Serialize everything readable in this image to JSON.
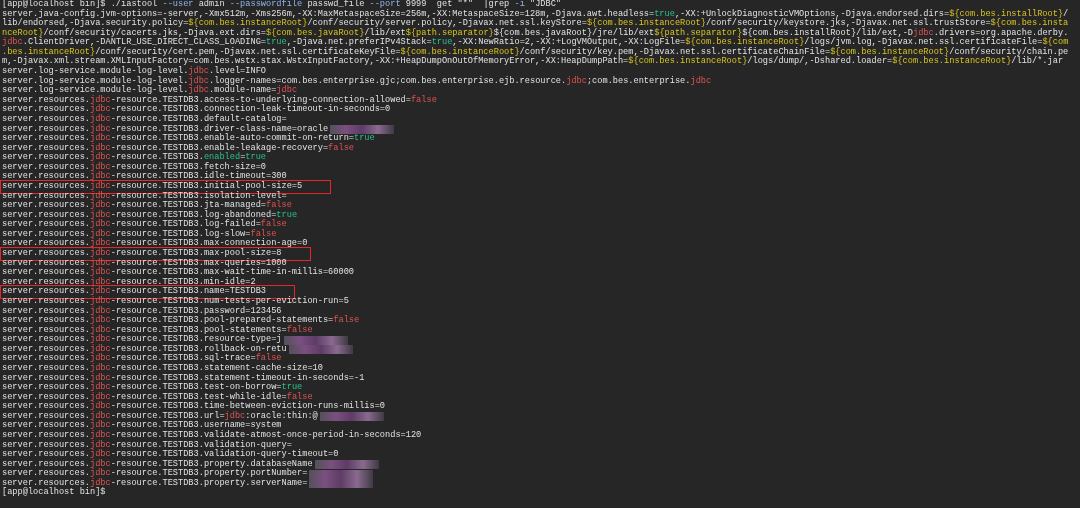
{
  "terminal": {
    "rows": [
      {
        "highlighted": false,
        "redacted": false,
        "segments": [
          {
            "kind": "plain",
            "text": "[app@localhost bin]$ ./iastool "
          },
          {
            "kind": "option",
            "text": "--user"
          },
          {
            "kind": "plain",
            "text": " admin "
          },
          {
            "kind": "option",
            "text": "--passwordfile"
          },
          {
            "kind": "plain",
            "text": " passwd_file "
          },
          {
            "kind": "option",
            "text": "--port"
          },
          {
            "kind": "plain",
            "text": " 9999  get \"*\"  |grep "
          },
          {
            "kind": "option",
            "text": "-i"
          },
          {
            "kind": "plain",
            "text": " \"JDBC\""
          }
        ]
      },
      {
        "highlighted": false,
        "redacted": false,
        "segments": [
          {
            "kind": "plain",
            "text": "server.java-config.jvm-options=-server,-Xmx512m,-Xms256m,-XX:MaxMetaspaceSize=256m,-XX:MetaspaceSize=128m,-Djava.awt.headless="
          },
          {
            "kind": "true",
            "text": "true"
          },
          {
            "kind": "plain",
            "text": ",-XX:+UnlockDiagnosticVMOptions,-Djava.endorsed.dirs="
          },
          {
            "kind": "var",
            "text": "${com.bes.installRoot}"
          },
          {
            "kind": "plain",
            "text": "/"
          }
        ]
      },
      {
        "highlighted": false,
        "redacted": false,
        "segments": [
          {
            "kind": "plain",
            "text": "lib/endorsed,-Djava.security.policy="
          },
          {
            "kind": "var",
            "text": "${com.bes.instanceRoot}"
          },
          {
            "kind": "plain",
            "text": "/conf/security/server.policy,-Djavax.net.ssl.keyStore="
          },
          {
            "kind": "var",
            "text": "${com.bes.instanceRoot}"
          },
          {
            "kind": "plain",
            "text": "/conf/security/keystore.jks,-Djavax.net.ssl.trustStore="
          },
          {
            "kind": "var",
            "text": "${com.bes.insta"
          }
        ]
      },
      {
        "highlighted": false,
        "redacted": false,
        "segments": [
          {
            "kind": "var",
            "text": "nceRoot}"
          },
          {
            "kind": "plain",
            "text": "/conf/security/cacerts.jks,-Djava.ext.dirs="
          },
          {
            "kind": "var",
            "text": "${com.bes.javaRoot}"
          },
          {
            "kind": "plain",
            "text": "/lib/ext"
          },
          {
            "kind": "var",
            "text": "${path.separator}"
          },
          {
            "kind": "plain",
            "text": "${com.bes.javaRoot}/jre/lib/ext"
          },
          {
            "kind": "var",
            "text": "${path.separator}"
          },
          {
            "kind": "plain",
            "text": "${com.bes.installRoot}/lib/ext,-D"
          },
          {
            "kind": "keyword",
            "text": "jdbc"
          },
          {
            "kind": "plain",
            "text": ".drivers=org.apache.derby."
          }
        ]
      },
      {
        "highlighted": false,
        "redacted": false,
        "segments": [
          {
            "kind": "keyword",
            "text": "jdbc"
          },
          {
            "kind": "plain",
            "text": ".ClientDriver,-DANTLR_USE_DIRECT_CLASS_LOADING="
          },
          {
            "kind": "true",
            "text": "true"
          },
          {
            "kind": "plain",
            "text": ",-Djava.net.preferIPv4Stack="
          },
          {
            "kind": "true",
            "text": "true"
          },
          {
            "kind": "plain",
            "text": ",-XX:NewRatio=2,-XX:+LogVMOutput,-XX:LogFile="
          },
          {
            "kind": "var",
            "text": "${com.bes.instanceRoot}"
          },
          {
            "kind": "plain",
            "text": "/logs/jvm.log,-Djavax.net.ssl.certificateFile="
          },
          {
            "kind": "var",
            "text": "${com"
          }
        ]
      },
      {
        "highlighted": false,
        "redacted": false,
        "segments": [
          {
            "kind": "var",
            "text": ".bes.instanceRoot}"
          },
          {
            "kind": "plain",
            "text": "/conf/security/cert.pem,-Djavax.net.ssl.certificateKeyFile="
          },
          {
            "kind": "var",
            "text": "${com.bes.instanceRoot}"
          },
          {
            "kind": "plain",
            "text": "/conf/security/key.pem,-Djavax.net.ssl.certificateChainFile="
          },
          {
            "kind": "var",
            "text": "${com.bes.instanceRoot}"
          },
          {
            "kind": "plain",
            "text": "/conf/security/chain.pe"
          }
        ]
      },
      {
        "highlighted": false,
        "redacted": false,
        "segments": [
          {
            "kind": "plain",
            "text": "m,-Djavax.xml.stream.XMLInputFactory=com.bes.wstx.stax.WstxInputFactory,-XX:+HeapDumpOnOutOfMemoryError,-XX:HeapDumpPath="
          },
          {
            "kind": "var",
            "text": "${com.bes.instanceRoot}"
          },
          {
            "kind": "plain",
            "text": "/logs/dump/,-Dshared.loader="
          },
          {
            "kind": "var",
            "text": "${com.bes.instanceRoot}"
          },
          {
            "kind": "plain",
            "text": "/lib/*.jar"
          }
        ]
      },
      {
        "highlighted": false,
        "redacted": false,
        "segments": [
          {
            "kind": "plain",
            "text": "server.log-service.module-log-level."
          },
          {
            "kind": "keyword",
            "text": "jdbc"
          },
          {
            "kind": "plain",
            "text": ".level=INFO"
          }
        ]
      },
      {
        "highlighted": false,
        "redacted": false,
        "segments": [
          {
            "kind": "plain",
            "text": "server.log-service.module-log-level."
          },
          {
            "kind": "keyword",
            "text": "jdbc"
          },
          {
            "kind": "plain",
            "text": ".logger-names=com.bes.enterprise.gjc;com.bes.enterprise.ejb.resource."
          },
          {
            "kind": "keyword",
            "text": "jdbc"
          },
          {
            "kind": "plain",
            "text": ";com.bes.enterprise."
          },
          {
            "kind": "keyword",
            "text": "jdbc"
          }
        ]
      },
      {
        "highlighted": false,
        "redacted": false,
        "segments": [
          {
            "kind": "plain",
            "text": "server.log-service.module-log-level."
          },
          {
            "kind": "keyword",
            "text": "jdbc"
          },
          {
            "kind": "plain",
            "text": ".module-name="
          },
          {
            "kind": "keyword",
            "text": "jdbc"
          }
        ]
      },
      {
        "highlighted": false,
        "redacted": false,
        "segments": [
          {
            "kind": "plain",
            "text": "server.resources."
          },
          {
            "kind": "keyword",
            "text": "jdbc"
          },
          {
            "kind": "plain",
            "text": "-resource.TESTDB3.access-to-underlying-connection-allowed="
          },
          {
            "kind": "false",
            "text": "false"
          }
        ]
      },
      {
        "highlighted": false,
        "redacted": false,
        "segments": [
          {
            "kind": "plain",
            "text": "server.resources."
          },
          {
            "kind": "keyword",
            "text": "jdbc"
          },
          {
            "kind": "plain",
            "text": "-resource.TESTDB3.connection-leak-timeout-in-seconds=0"
          }
        ]
      },
      {
        "highlighted": false,
        "redacted": false,
        "segments": [
          {
            "kind": "plain",
            "text": "server.resources."
          },
          {
            "kind": "keyword",
            "text": "jdbc"
          },
          {
            "kind": "plain",
            "text": "-resource.TESTDB3.default-catalog="
          }
        ]
      },
      {
        "highlighted": false,
        "redacted": true,
        "segments": [
          {
            "kind": "plain",
            "text": "server.resources."
          },
          {
            "kind": "keyword",
            "text": "jdbc"
          },
          {
            "kind": "plain",
            "text": "-resource.TESTDB3.driver-class-name=oracle"
          }
        ]
      },
      {
        "highlighted": false,
        "redacted": false,
        "segments": [
          {
            "kind": "plain",
            "text": "server.resources."
          },
          {
            "kind": "keyword",
            "text": "jdbc"
          },
          {
            "kind": "plain",
            "text": "-resource.TESTDB3.enable-auto-commit-on-return="
          },
          {
            "kind": "true",
            "text": "true"
          }
        ]
      },
      {
        "highlighted": false,
        "redacted": false,
        "segments": [
          {
            "kind": "plain",
            "text": "server.resources."
          },
          {
            "kind": "keyword",
            "text": "jdbc"
          },
          {
            "kind": "plain",
            "text": "-resource.TESTDB3.enable-leakage-recovery="
          },
          {
            "kind": "false",
            "text": "false"
          }
        ]
      },
      {
        "highlighted": false,
        "redacted": false,
        "segments": [
          {
            "kind": "plain",
            "text": "server.resources."
          },
          {
            "kind": "keyword",
            "text": "jdbc"
          },
          {
            "kind": "plain",
            "text": "-resource.TESTDB3."
          },
          {
            "kind": "true",
            "text": "enabled"
          },
          {
            "kind": "plain",
            "text": "="
          },
          {
            "kind": "true",
            "text": "true"
          }
        ]
      },
      {
        "highlighted": false,
        "redacted": false,
        "segments": [
          {
            "kind": "plain",
            "text": "server.resources."
          },
          {
            "kind": "keyword",
            "text": "jdbc"
          },
          {
            "kind": "plain",
            "text": "-resource.TESTDB3.fetch-size=0"
          }
        ]
      },
      {
        "highlighted": false,
        "redacted": false,
        "segments": [
          {
            "kind": "plain",
            "text": "server.resources."
          },
          {
            "kind": "keyword",
            "text": "jdbc"
          },
          {
            "kind": "plain",
            "text": "-resource.TESTDB3.idle-timeout=300"
          }
        ]
      },
      {
        "highlighted": true,
        "redacted": false,
        "segments": [
          {
            "kind": "plain",
            "text": "server.resources."
          },
          {
            "kind": "keyword",
            "text": "jdbc"
          },
          {
            "kind": "plain",
            "text": "-resource.TESTDB3.initial-pool-size=5"
          }
        ]
      },
      {
        "highlighted": false,
        "redacted": false,
        "segments": [
          {
            "kind": "plain",
            "text": "server.resources."
          },
          {
            "kind": "keyword",
            "text": "jdbc"
          },
          {
            "kind": "plain",
            "text": "-resource.TESTDB3.isolation-level="
          }
        ]
      },
      {
        "highlighted": false,
        "redacted": false,
        "segments": [
          {
            "kind": "plain",
            "text": "server.resources."
          },
          {
            "kind": "keyword",
            "text": "jdbc"
          },
          {
            "kind": "plain",
            "text": "-resource.TESTDB3.jta-managed="
          },
          {
            "kind": "false",
            "text": "false"
          }
        ]
      },
      {
        "highlighted": false,
        "redacted": false,
        "segments": [
          {
            "kind": "plain",
            "text": "server.resources."
          },
          {
            "kind": "keyword",
            "text": "jdbc"
          },
          {
            "kind": "plain",
            "text": "-resource.TESTDB3.log-abandoned="
          },
          {
            "kind": "true",
            "text": "true"
          }
        ]
      },
      {
        "highlighted": false,
        "redacted": false,
        "segments": [
          {
            "kind": "plain",
            "text": "server.resources."
          },
          {
            "kind": "keyword",
            "text": "jdbc"
          },
          {
            "kind": "plain",
            "text": "-resource.TESTDB3.log-failed="
          },
          {
            "kind": "false",
            "text": "false"
          }
        ]
      },
      {
        "highlighted": false,
        "redacted": false,
        "segments": [
          {
            "kind": "plain",
            "text": "server.resources."
          },
          {
            "kind": "keyword",
            "text": "jdbc"
          },
          {
            "kind": "plain",
            "text": "-resource.TESTDB3.log-slow="
          },
          {
            "kind": "false",
            "text": "false"
          }
        ]
      },
      {
        "highlighted": false,
        "redacted": false,
        "segments": [
          {
            "kind": "plain",
            "text": "server.resources."
          },
          {
            "kind": "keyword",
            "text": "jdbc"
          },
          {
            "kind": "plain",
            "text": "-resource.TESTDB3.max-connection-age=0"
          }
        ]
      },
      {
        "highlighted": true,
        "redacted": false,
        "segments": [
          {
            "kind": "plain",
            "text": "server.resources."
          },
          {
            "kind": "keyword",
            "text": "jdbc"
          },
          {
            "kind": "plain",
            "text": "-resource.TESTDB3.max-pool-size=8"
          }
        ]
      },
      {
        "highlighted": false,
        "redacted": false,
        "segments": [
          {
            "kind": "plain",
            "text": "server.resources."
          },
          {
            "kind": "keyword",
            "text": "jdbc"
          },
          {
            "kind": "plain",
            "text": "-resource.TESTDB3.max-queries=1000"
          }
        ]
      },
      {
        "highlighted": false,
        "redacted": false,
        "segments": [
          {
            "kind": "plain",
            "text": "server.resources."
          },
          {
            "kind": "keyword",
            "text": "jdbc"
          },
          {
            "kind": "plain",
            "text": "-resource.TESTDB3.max-wait-time-in-millis=60000"
          }
        ]
      },
      {
        "highlighted": false,
        "redacted": false,
        "segments": [
          {
            "kind": "plain",
            "text": "server.resources."
          },
          {
            "kind": "keyword",
            "text": "jdbc"
          },
          {
            "kind": "plain",
            "text": "-resource.TESTDB3.min-idle=2"
          }
        ]
      },
      {
        "highlighted": true,
        "redacted": false,
        "segments": [
          {
            "kind": "plain",
            "text": "server.resources."
          },
          {
            "kind": "keyword",
            "text": "jdbc"
          },
          {
            "kind": "plain",
            "text": "-resource.TESTDB3.name=TESTDB3"
          }
        ]
      },
      {
        "highlighted": false,
        "redacted": false,
        "segments": [
          {
            "kind": "plain",
            "text": "server.resources."
          },
          {
            "kind": "keyword",
            "text": "jdbc"
          },
          {
            "kind": "plain",
            "text": "-resource.TESTDB3.num-tests-per-eviction-run=5"
          }
        ]
      },
      {
        "highlighted": false,
        "redacted": false,
        "segments": [
          {
            "kind": "plain",
            "text": "server.resources."
          },
          {
            "kind": "keyword",
            "text": "jdbc"
          },
          {
            "kind": "plain",
            "text": "-resource.TESTDB3.password=123456"
          }
        ]
      },
      {
        "highlighted": false,
        "redacted": false,
        "segments": [
          {
            "kind": "plain",
            "text": "server.resources."
          },
          {
            "kind": "keyword",
            "text": "jdbc"
          },
          {
            "kind": "plain",
            "text": "-resource.TESTDB3.pool-prepared-statements="
          },
          {
            "kind": "false",
            "text": "false"
          }
        ]
      },
      {
        "highlighted": false,
        "redacted": false,
        "segments": [
          {
            "kind": "plain",
            "text": "server.resources."
          },
          {
            "kind": "keyword",
            "text": "jdbc"
          },
          {
            "kind": "plain",
            "text": "-resource.TESTDB3.pool-statements="
          },
          {
            "kind": "false",
            "text": "false"
          }
        ]
      },
      {
        "highlighted": false,
        "redacted": true,
        "segments": [
          {
            "kind": "plain",
            "text": "server.resources."
          },
          {
            "kind": "keyword",
            "text": "jdbc"
          },
          {
            "kind": "plain",
            "text": "-resource.TESTDB3.resource-type=j"
          }
        ]
      },
      {
        "highlighted": false,
        "redacted": true,
        "segments": [
          {
            "kind": "plain",
            "text": "server.resources."
          },
          {
            "kind": "keyword",
            "text": "jdbc"
          },
          {
            "kind": "plain",
            "text": "-resource.TESTDB3.rollback-on-retu"
          }
        ]
      },
      {
        "highlighted": false,
        "redacted": false,
        "segments": [
          {
            "kind": "plain",
            "text": "server.resources."
          },
          {
            "kind": "keyword",
            "text": "jdbc"
          },
          {
            "kind": "plain",
            "text": "-resource.TESTDB3.sql-trace="
          },
          {
            "kind": "false",
            "text": "false"
          }
        ]
      },
      {
        "highlighted": false,
        "redacted": false,
        "segments": [
          {
            "kind": "plain",
            "text": "server.resources."
          },
          {
            "kind": "keyword",
            "text": "jdbc"
          },
          {
            "kind": "plain",
            "text": "-resource.TESTDB3.statement-cache-size=10"
          }
        ]
      },
      {
        "highlighted": false,
        "redacted": false,
        "segments": [
          {
            "kind": "plain",
            "text": "server.resources."
          },
          {
            "kind": "keyword",
            "text": "jdbc"
          },
          {
            "kind": "plain",
            "text": "-resource.TESTDB3.statement-timeout-in-seconds=-1"
          }
        ]
      },
      {
        "highlighted": false,
        "redacted": false,
        "segments": [
          {
            "kind": "plain",
            "text": "server.resources."
          },
          {
            "kind": "keyword",
            "text": "jdbc"
          },
          {
            "kind": "plain",
            "text": "-resource.TESTDB3.test-on-borrow="
          },
          {
            "kind": "true",
            "text": "true"
          }
        ]
      },
      {
        "highlighted": false,
        "redacted": false,
        "segments": [
          {
            "kind": "plain",
            "text": "server.resources."
          },
          {
            "kind": "keyword",
            "text": "jdbc"
          },
          {
            "kind": "plain",
            "text": "-resource.TESTDB3.test-while-idle="
          },
          {
            "kind": "false",
            "text": "false"
          }
        ]
      },
      {
        "highlighted": false,
        "redacted": false,
        "segments": [
          {
            "kind": "plain",
            "text": "server.resources."
          },
          {
            "kind": "keyword",
            "text": "jdbc"
          },
          {
            "kind": "plain",
            "text": "-resource.TESTDB3.time-between-eviction-runs-millis=0"
          }
        ]
      },
      {
        "highlighted": false,
        "redacted": true,
        "segments": [
          {
            "kind": "plain",
            "text": "server.resources."
          },
          {
            "kind": "keyword",
            "text": "jdbc"
          },
          {
            "kind": "plain",
            "text": "-resource.TESTDB3.url="
          },
          {
            "kind": "keyword",
            "text": "jdbc"
          },
          {
            "kind": "plain",
            "text": ":oracle:thin:@"
          }
        ]
      },
      {
        "highlighted": false,
        "redacted": false,
        "segments": [
          {
            "kind": "plain",
            "text": "server.resources."
          },
          {
            "kind": "keyword",
            "text": "jdbc"
          },
          {
            "kind": "plain",
            "text": "-resource.TESTDB3.username=system"
          }
        ]
      },
      {
        "highlighted": false,
        "redacted": false,
        "segments": [
          {
            "kind": "plain",
            "text": "server.resources."
          },
          {
            "kind": "keyword",
            "text": "jdbc"
          },
          {
            "kind": "plain",
            "text": "-resource.TESTDB3.validate-atmost-once-period-in-seconds=120"
          }
        ]
      },
      {
        "highlighted": false,
        "redacted": false,
        "segments": [
          {
            "kind": "plain",
            "text": "server.resources."
          },
          {
            "kind": "keyword",
            "text": "jdbc"
          },
          {
            "kind": "plain",
            "text": "-resource.TESTDB3.validation-query="
          }
        ]
      },
      {
        "highlighted": false,
        "redacted": false,
        "segments": [
          {
            "kind": "plain",
            "text": "server.resources."
          },
          {
            "kind": "keyword",
            "text": "jdbc"
          },
          {
            "kind": "plain",
            "text": "-resource.TESTDB3.validation-query-timeout=0"
          }
        ]
      },
      {
        "highlighted": false,
        "redacted": true,
        "segments": [
          {
            "kind": "plain",
            "text": "server.resources."
          },
          {
            "kind": "keyword",
            "text": "jdbc"
          },
          {
            "kind": "plain",
            "text": "-resource.TESTDB3.property.databaseName"
          }
        ]
      },
      {
        "highlighted": false,
        "redacted": true,
        "segments": [
          {
            "kind": "plain",
            "text": "server.resources."
          },
          {
            "kind": "keyword",
            "text": "jdbc"
          },
          {
            "kind": "plain",
            "text": "-resource.TESTDB3.property.portNumber="
          }
        ]
      },
      {
        "highlighted": false,
        "redacted": true,
        "segments": [
          {
            "kind": "plain",
            "text": "server.resources."
          },
          {
            "kind": "keyword",
            "text": "jdbc"
          },
          {
            "kind": "plain",
            "text": "-resource.TESTDB3.property.serverName="
          }
        ]
      },
      {
        "highlighted": false,
        "redacted": false,
        "segments": [
          {
            "kind": "plain",
            "text": "[app@localhost bin]$"
          }
        ]
      }
    ]
  }
}
